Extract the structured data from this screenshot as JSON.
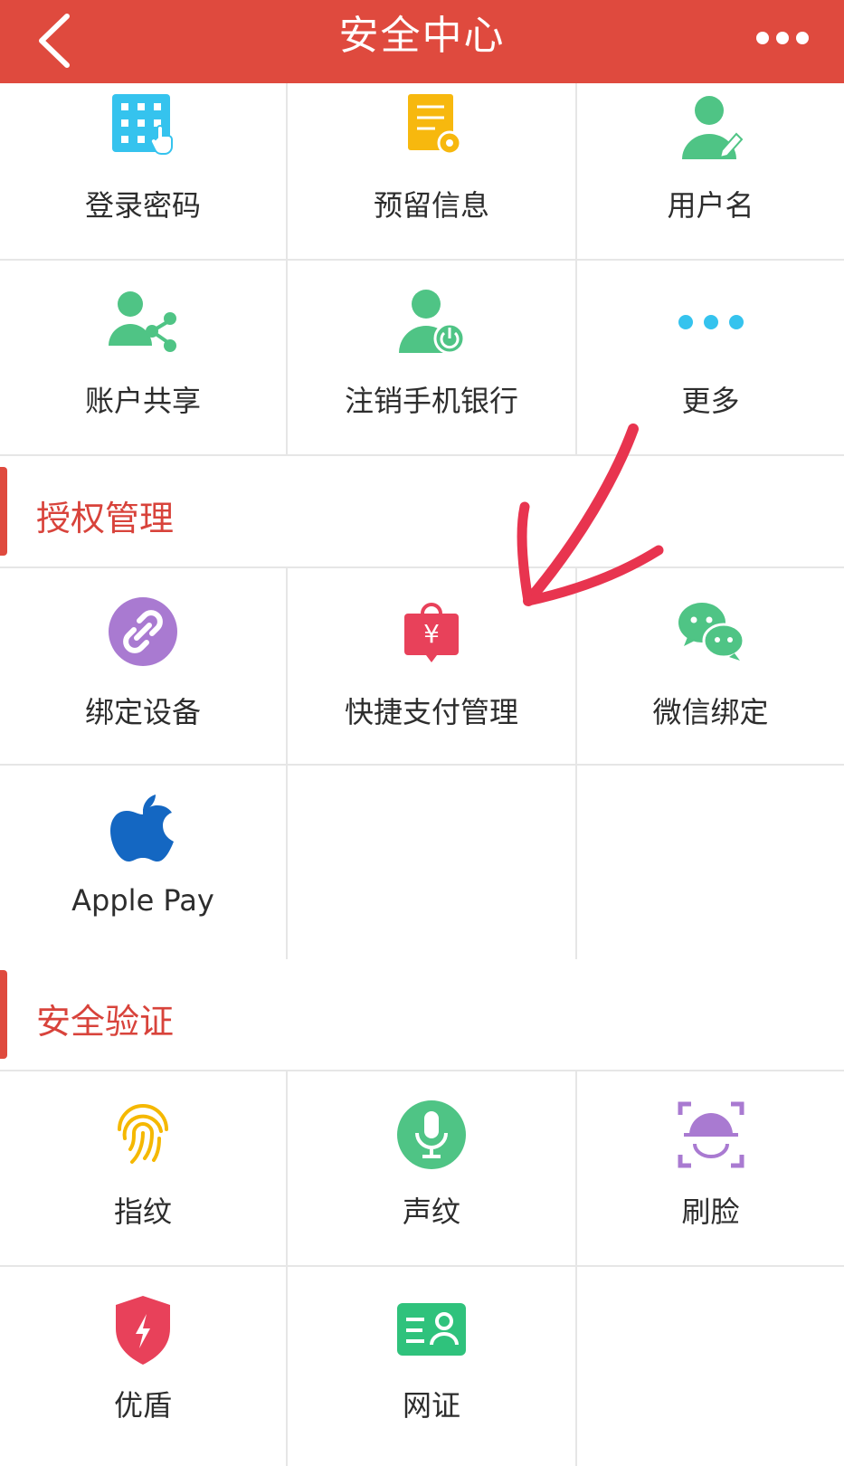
{
  "header": {
    "title": "安全中心",
    "back_icon": "chevron-left-icon",
    "more_icon": "more-dots-icon"
  },
  "account_items": [
    {
      "label": "登录密码",
      "icon": "keypad-icon",
      "color": "#35c3ee"
    },
    {
      "label": "预留信息",
      "icon": "document-gear-icon",
      "color": "#f7b80e"
    },
    {
      "label": "用户名",
      "icon": "user-edit-icon",
      "color": "#4fc485"
    },
    {
      "label": "账户共享",
      "icon": "user-share-icon",
      "color": "#4fc485"
    },
    {
      "label": "注销手机银行",
      "icon": "user-power-icon",
      "color": "#4fc485"
    },
    {
      "label": "更多",
      "icon": "more-dots-icon",
      "color": "#35c3ee"
    }
  ],
  "auth_section": {
    "title": "授权管理",
    "items": [
      {
        "label": "绑定设备",
        "icon": "link-icon",
        "color": "#a97ad1"
      },
      {
        "label": "快捷支付管理",
        "icon": "yen-bag-icon",
        "color": "#e8415a"
      },
      {
        "label": "微信绑定",
        "icon": "wechat-icon",
        "color": "#4fc485"
      },
      {
        "label": "Apple Pay",
        "icon": "apple-icon",
        "color": "#1467c2"
      }
    ]
  },
  "security_section": {
    "title": "安全验证",
    "items": [
      {
        "label": "指纹",
        "icon": "fingerprint-icon",
        "color": "#f5b800"
      },
      {
        "label": "声纹",
        "icon": "microphone-icon",
        "color": "#4fc485"
      },
      {
        "label": "刷脸",
        "icon": "face-scan-icon",
        "color": "#a97ad1"
      },
      {
        "label": "优盾",
        "icon": "shield-bolt-icon",
        "color": "#e8415a"
      },
      {
        "label": "网证",
        "icon": "id-card-icon",
        "color": "#2fc27c"
      }
    ]
  },
  "colors": {
    "header": "#df4a3e",
    "section_title": "#d8433b",
    "annotation_arrow": "#e8344f"
  }
}
